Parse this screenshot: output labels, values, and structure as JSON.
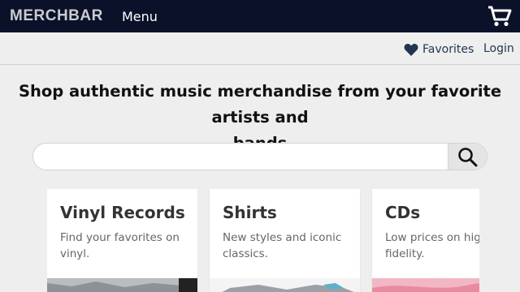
{
  "header": {
    "logo": "MERCHBAR",
    "menu_label": "Menu",
    "cart_icon": "shopping-cart-icon"
  },
  "subnav": {
    "favorites_label": "Favorites",
    "favorites_icon": "heart-icon",
    "login_label": "Login"
  },
  "tagline_line1": "Shop authentic music merchandise from your favorite artists and",
  "tagline_line2": "bands",
  "search": {
    "value": "",
    "placeholder": "",
    "button_icon": "search-icon"
  },
  "categories": [
    {
      "title": "Vinyl Records",
      "desc_line1": "Find your favorites on",
      "desc_line2": "vinyl."
    },
    {
      "title": "Shirts",
      "desc_line1": "New styles and iconic",
      "desc_line2": "classics."
    },
    {
      "title": "CDs",
      "desc_line1": "Low prices on high",
      "desc_line2": "fidelity."
    }
  ],
  "colors": {
    "topbar": "#0b1128",
    "background": "#eeeeee",
    "link": "#1f3550"
  }
}
